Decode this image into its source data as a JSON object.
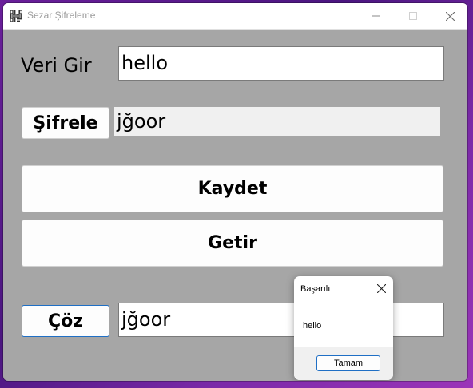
{
  "window": {
    "title": "Sezar Şifreleme",
    "icon": "binary-icon",
    "controls": [
      "minimize-icon",
      "maximize-icon",
      "close-icon"
    ]
  },
  "form": {
    "veri_label": "Veri Gir",
    "veri_value": "hello",
    "sifrele_label": "Şifrele",
    "sifreli_value": "jğoor",
    "kaydet_label": "Kaydet",
    "getir_label": "Getir",
    "coz_label": "Çöz",
    "coz_value": "jğoor"
  },
  "dialog": {
    "title": "Başarılı",
    "message": "hello",
    "ok_label": "Tamam"
  },
  "colors": {
    "form_background": "#a6a6a6",
    "focus_border": "#1f6fc5"
  }
}
